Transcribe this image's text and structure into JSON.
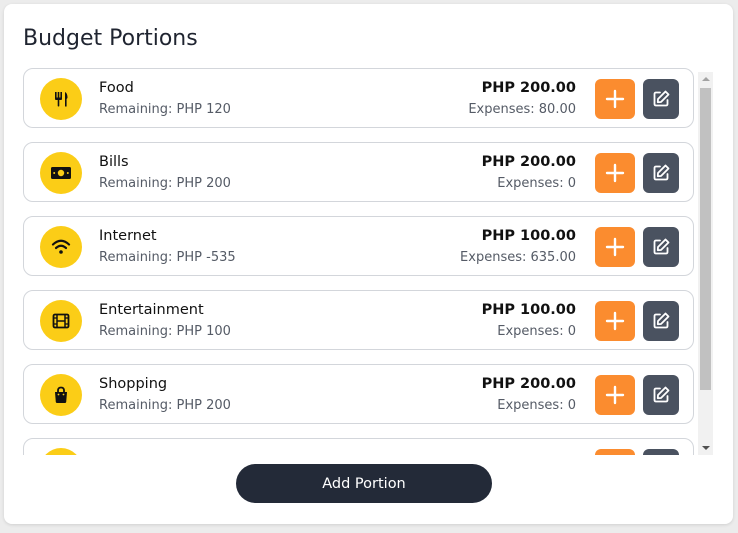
{
  "title": "Budget Portions",
  "colors": {
    "icon_bg": "#fbcd17",
    "add_button": "#fb8c2f",
    "edit_button": "#4a5260",
    "primary_button": "#232a38"
  },
  "portions": [
    {
      "name": "Food",
      "remaining": "Remaining: PHP 120",
      "amount": "PHP 200.00",
      "expenses": "Expenses: 80.00",
      "icon": "utensils-icon"
    },
    {
      "name": "Bills",
      "remaining": "Remaining: PHP 200",
      "amount": "PHP 200.00",
      "expenses": "Expenses: 0",
      "icon": "money-bill-icon"
    },
    {
      "name": "Internet",
      "remaining": "Remaining: PHP -535",
      "amount": "PHP 100.00",
      "expenses": "Expenses: 635.00",
      "icon": "wifi-icon"
    },
    {
      "name": "Entertainment",
      "remaining": "Remaining: PHP 100",
      "amount": "PHP 100.00",
      "expenses": "Expenses: 0",
      "icon": "film-icon"
    },
    {
      "name": "Shopping",
      "remaining": "Remaining: PHP 200",
      "amount": "PHP 200.00",
      "expenses": "Expenses: 0",
      "icon": "shopping-bag-icon"
    },
    {
      "name": "",
      "remaining": "",
      "amount": "",
      "expenses": "",
      "icon": "category-icon"
    }
  ],
  "add_portion_label": "Add Portion"
}
